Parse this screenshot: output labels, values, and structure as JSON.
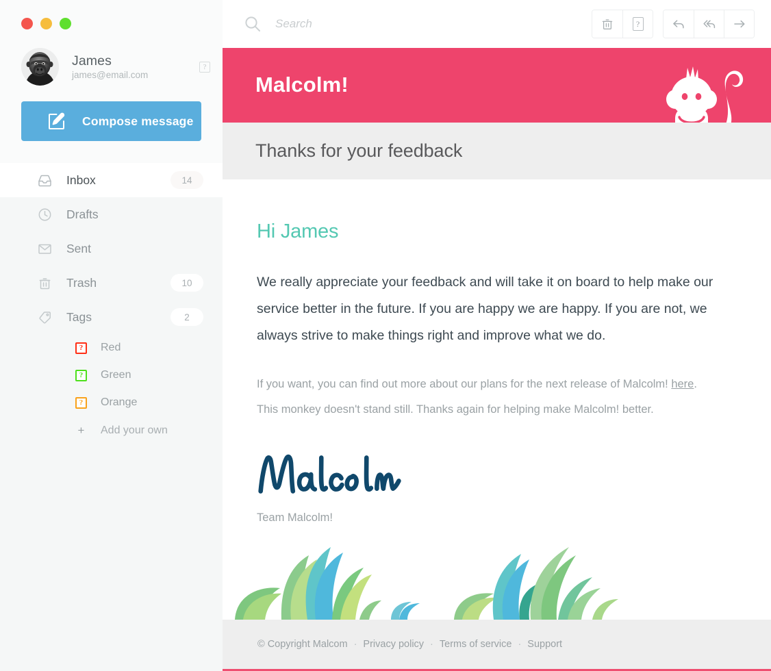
{
  "window": {
    "traffic_lights": [
      {
        "name": "close",
        "color": "#f4564e"
      },
      {
        "name": "minimize",
        "color": "#f6bd3d"
      },
      {
        "name": "maximize",
        "color": "#5fdf2e"
      }
    ]
  },
  "sidebar": {
    "account": {
      "name": "James",
      "email": "james@email.com",
      "avatar_icon": "gorilla-avatar",
      "missing_glyph": "?"
    },
    "compose": {
      "label": "Compose message",
      "icon": "compose-pencil-icon",
      "color": "#5aaedd"
    },
    "nav": [
      {
        "label": "Inbox",
        "icon": "inbox-icon",
        "badge": "14",
        "active": true
      },
      {
        "label": "Drafts",
        "icon": "clock-icon",
        "badge": "",
        "active": false
      },
      {
        "label": "Sent",
        "icon": "envelope-icon",
        "badge": "",
        "active": false
      },
      {
        "label": "Trash",
        "icon": "trash-icon",
        "badge": "10",
        "active": false
      },
      {
        "label": "Tags",
        "icon": "tag-icon",
        "badge": "2",
        "active": false
      }
    ],
    "tags": [
      {
        "label": "Red",
        "color": "#ff2f16",
        "glyph": "?"
      },
      {
        "label": "Green",
        "color": "#4ee01d",
        "glyph": "?"
      },
      {
        "label": "Orange",
        "color": "#f9a21b",
        "glyph": "?"
      }
    ],
    "add_tag": {
      "label": "Add your own",
      "icon": "plus-icon",
      "glyph": "+"
    }
  },
  "toolbar": {
    "search": {
      "placeholder": "Search",
      "value": "",
      "icon": "search-icon"
    },
    "buttons": [
      {
        "name": "delete-button",
        "icon": "trash-icon",
        "glyph": ""
      },
      {
        "name": "missing-button",
        "icon": "missing-glyph-icon",
        "glyph": "?"
      },
      {
        "name": "reply-button",
        "icon": "reply-arrow-icon",
        "glyph": ""
      },
      {
        "name": "reply-all-button",
        "icon": "reply-all-arrow-icon",
        "glyph": ""
      },
      {
        "name": "forward-button",
        "icon": "forward-arrow-icon",
        "glyph": ""
      }
    ]
  },
  "email": {
    "banner": {
      "brand": "Malcolm!",
      "color": "#ee446c",
      "mascot_icon": "monkey-mascot-icon"
    },
    "subject": "Thanks for your feedback",
    "greeting": "Hi James",
    "greeting_color": "#54c8b2",
    "paragraph_main": "We really appreciate your feedback and will take it on board to help make our service better in the future. If you are happy we are happy. If you are not, we always strive to make things right and improve what we do.",
    "paragraph_sub_prefix": "If you want, you can find out more about our plans for the next release of Malcolm! ",
    "paragraph_sub_link": "here",
    "paragraph_sub_suffix": ".",
    "paragraph_sub_2": "This monkey doesn't stand still. Thanks again for helping make Malcolm! better.",
    "signature_script": "Malcolm",
    "signature_color": "#10486b",
    "team_line": "Team Malcolm!",
    "foliage_icon": "jungle-leaves-illustration",
    "footer": {
      "copyright": "© Copyright Malcom",
      "links": [
        "Privacy policy",
        "Terms of service",
        "Support"
      ],
      "separator": "·"
    }
  }
}
